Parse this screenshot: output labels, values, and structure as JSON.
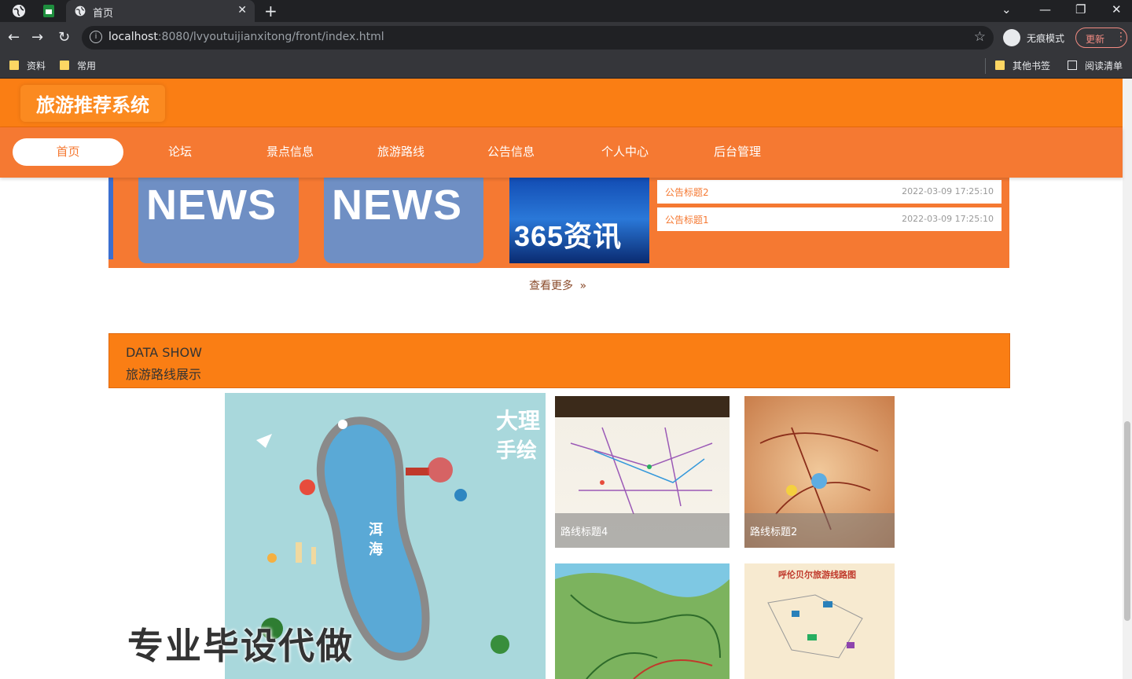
{
  "browser": {
    "tab_title": "首页",
    "url_host": "localhost",
    "url_rest": ":8080/lvyoutuijianxitong/front/index.html",
    "incognito_label": "无痕模式",
    "update_label": "更新",
    "bookmarks": [
      {
        "label": "资料"
      },
      {
        "label": "常用"
      }
    ],
    "other_bookmarks": "其他书签",
    "reading_list": "阅读清单"
  },
  "site": {
    "brand": "旅游推荐系统"
  },
  "nav": {
    "active": "首页",
    "items": [
      "论坛",
      "景点信息",
      "旅游路线",
      "公告信息",
      "个人中心",
      "后台管理"
    ]
  },
  "news": {
    "images": [
      {
        "text": "NEWS"
      },
      {
        "text": "NEWS"
      },
      {
        "text": "365资讯"
      }
    ],
    "notices": [
      {
        "title": "公告标题2",
        "date": "2022-03-09 17:25:10"
      },
      {
        "title": "公告标题1",
        "date": "2022-03-09 17:25:10"
      }
    ],
    "more_label": "查看更多"
  },
  "section": {
    "en": "DATA SHOW",
    "cn": "旅游路线展示"
  },
  "routes": {
    "big_map_labels": [
      "大理",
      "手绘",
      "洱",
      "海"
    ],
    "cards": [
      {
        "caption": "路线标题4"
      },
      {
        "caption": "路线标题2"
      },
      {
        "caption": ""
      },
      {
        "caption": ""
      }
    ],
    "card3_heading": "呼伦贝尔旅游线路图"
  },
  "overlay": {
    "watermark": "专业毕设代做"
  },
  "colors": {
    "header": "#fa7e14",
    "nav": "#f57932",
    "chrome_dark": "#202124",
    "chrome": "#35363a"
  }
}
